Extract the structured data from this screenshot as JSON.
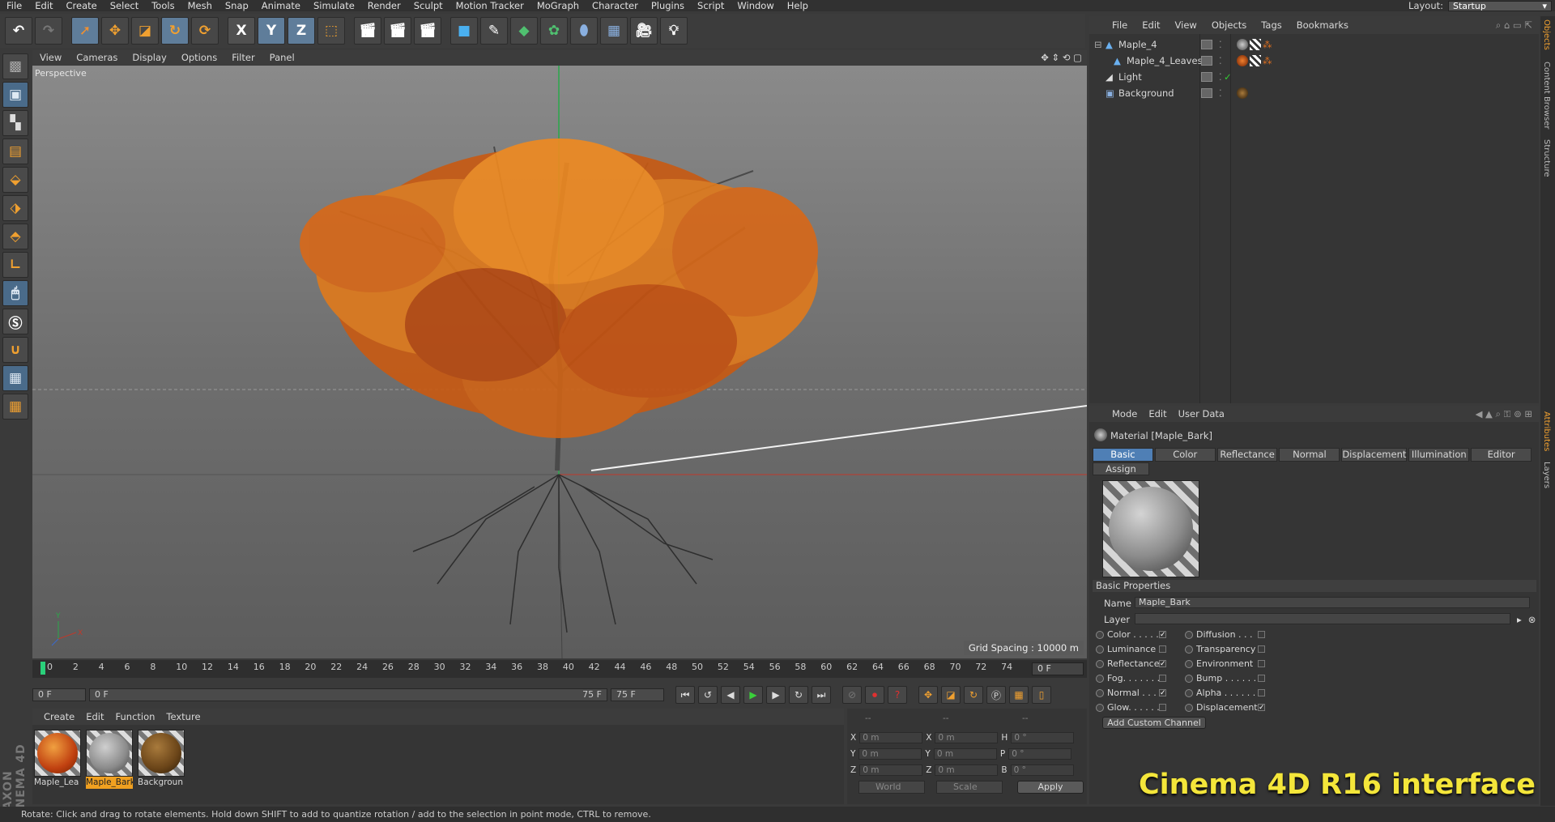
{
  "menubar": {
    "items": [
      "File",
      "Edit",
      "Create",
      "Select",
      "Tools",
      "Mesh",
      "Snap",
      "Animate",
      "Simulate",
      "Render",
      "Sculpt",
      "Motion Tracker",
      "MoGraph",
      "Character",
      "Plugins",
      "Script",
      "Window",
      "Help"
    ],
    "layout_label": "Layout:",
    "layout_value": "Startup"
  },
  "toolbar": {
    "axis_x": "X",
    "axis_y": "Y",
    "axis_z": "Z"
  },
  "viewport": {
    "menu": [
      "View",
      "Cameras",
      "Display",
      "Options",
      "Filter",
      "Panel"
    ],
    "label": "Perspective",
    "grid_spacing": "Grid Spacing : 10000 m"
  },
  "timeline": {
    "ticks": [
      "0",
      "2",
      "4",
      "6",
      "8",
      "10",
      "12",
      "14",
      "16",
      "18",
      "20",
      "22",
      "24",
      "26",
      "28",
      "30",
      "32",
      "34",
      "36",
      "38",
      "40",
      "42",
      "44",
      "46",
      "48",
      "50",
      "52",
      "54",
      "56",
      "58",
      "60",
      "62",
      "64",
      "66",
      "68",
      "70",
      "72",
      "74"
    ],
    "current_frame": "0 F"
  },
  "playbar": {
    "start": "0 F",
    "range_start": "0 F",
    "range_end": "75 F",
    "end": "75 F"
  },
  "material_manager": {
    "menu": [
      "Create",
      "Edit",
      "Function",
      "Texture"
    ],
    "materials": [
      {
        "label": "Maple_Lea"
      },
      {
        "label": "Maple_Bark"
      },
      {
        "label": "Backgroun"
      }
    ]
  },
  "coordinates": {
    "headers": [
      "--",
      "--",
      "--"
    ],
    "rows": [
      {
        "a": "X",
        "av": "0 m",
        "b": "X",
        "bv": "0 m",
        "c": "H",
        "cv": "0 °"
      },
      {
        "a": "Y",
        "av": "0 m",
        "b": "Y",
        "bv": "0 m",
        "c": "P",
        "cv": "0 °"
      },
      {
        "a": "Z",
        "av": "0 m",
        "b": "Z",
        "bv": "0 m",
        "c": "B",
        "cv": "0 °"
      }
    ],
    "mode1": "World",
    "mode2": "Scale",
    "apply": "Apply"
  },
  "object_manager": {
    "menu": [
      "File",
      "Edit",
      "View",
      "Objects",
      "Tags",
      "Bookmarks"
    ],
    "objects": [
      {
        "name": "Maple_4"
      },
      {
        "name": "Maple_4_Leaves"
      },
      {
        "name": "Light"
      },
      {
        "name": "Background"
      }
    ]
  },
  "attributes": {
    "menu": [
      "Mode",
      "Edit",
      "User Data"
    ],
    "title": "Material [Maple_Bark]",
    "tabs": [
      "Basic",
      "Color",
      "Reflectance",
      "Normal",
      "Displacement",
      "Illumination",
      "Editor"
    ],
    "assign_tab": "Assign",
    "section": "Basic Properties",
    "name_label": "Name",
    "name_value": "Maple_Bark",
    "layer_label": "Layer",
    "channels_left": [
      {
        "label": "Color . . . . .",
        "checked": true
      },
      {
        "label": "Luminance",
        "checked": false
      },
      {
        "label": "Reflectance",
        "checked": true
      },
      {
        "label": "Fog. . . . . . .",
        "checked": false
      },
      {
        "label": "Normal . . . .",
        "checked": true
      },
      {
        "label": "Glow. . . . . .",
        "checked": false
      }
    ],
    "channels_right": [
      {
        "label": "Diffusion . . .",
        "checked": false
      },
      {
        "label": "Transparency",
        "checked": false
      },
      {
        "label": "Environment",
        "checked": false
      },
      {
        "label": "Bump . . . . . .",
        "checked": false
      },
      {
        "label": "Alpha . . . . . .",
        "checked": false
      },
      {
        "label": "Displacement",
        "checked": true
      }
    ],
    "add_channel": "Add Custom Channel"
  },
  "side_tabs": [
    "Objects",
    "Content Browser",
    "Structure",
    "Attributes",
    "Layers"
  ],
  "brand": "MAXON CINEMA 4D",
  "status": "Rotate: Click and drag to rotate elements. Hold down SHIFT to add to quantize rotation / add to the selection in point mode, CTRL to remove.",
  "caption": "Cinema 4D R16 interface"
}
